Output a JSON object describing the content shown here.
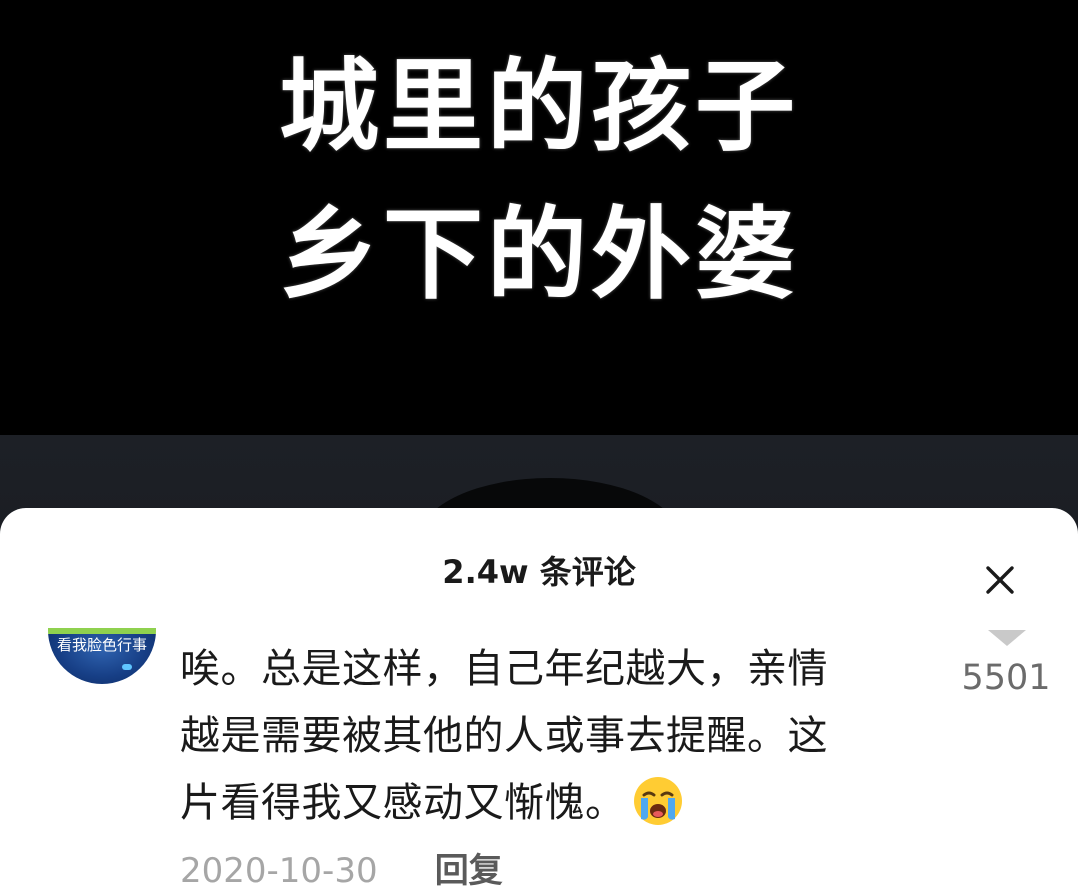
{
  "video": {
    "title_line_1": "城里的孩子",
    "title_line_2": "乡下的外婆"
  },
  "comments_panel": {
    "title": "2.4w 条评论",
    "close_icon": "close-icon",
    "comment": {
      "avatar_text": "看我脸色行事",
      "text_lines": [
        "唉。总是这样，自己年纪越大，亲情",
        "越是需要被其他的人或事去提醒。这",
        "片看得我又感动又惭愧。"
      ],
      "emoji": "crying-face-emoji",
      "like_icon": "thumbs-up-icon",
      "like_count": "5501",
      "date": "2020-10-30",
      "reply_label": "回复"
    }
  },
  "colors": {
    "panel_background": "#ffffff",
    "video_background": "#000000",
    "secondary_text": "#a6a6a6",
    "primary_text": "#1a1a1a"
  }
}
